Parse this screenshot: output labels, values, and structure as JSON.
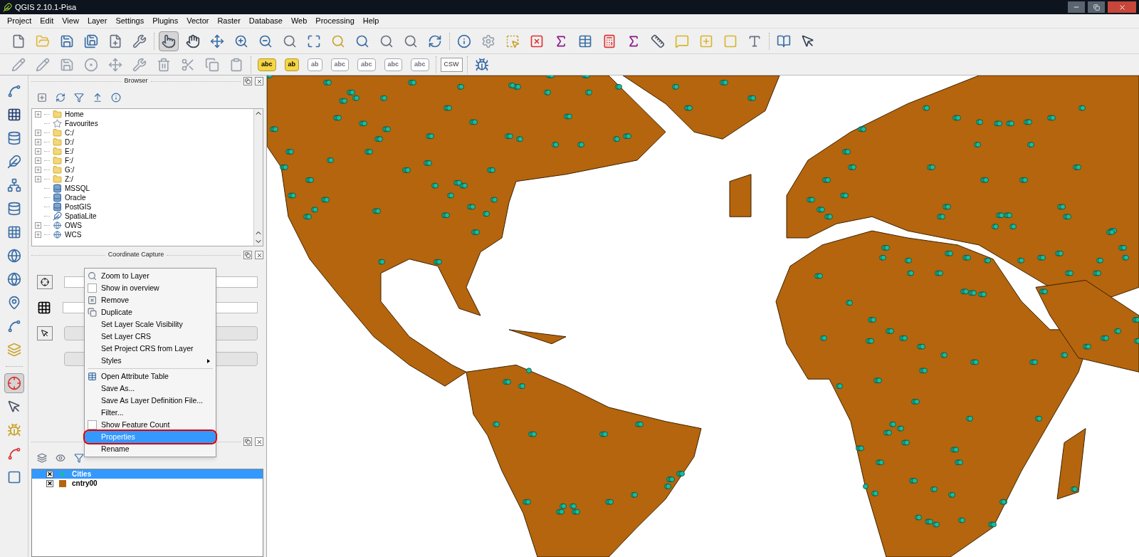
{
  "window": {
    "title": "QGIS 2.10.1-Pisa"
  },
  "menu": [
    "Project",
    "Edit",
    "View",
    "Layer",
    "Settings",
    "Plugins",
    "Vector",
    "Raster",
    "Database",
    "Web",
    "Processing",
    "Help"
  ],
  "pressed_tools": {
    "touch": true,
    "coordinate_capture": true
  },
  "label_toolbar": {
    "labels": [
      "abc",
      "ab",
      "ab",
      "abc",
      "abc",
      "abc",
      "abc"
    ],
    "csw": "CSW"
  },
  "browser": {
    "title": "Browser",
    "items": [
      {
        "label": "Home",
        "kind": "folder",
        "has_children": true
      },
      {
        "label": "Favourites",
        "kind": "star",
        "has_children": false
      },
      {
        "label": "C:/",
        "kind": "folder",
        "has_children": true
      },
      {
        "label": "D:/",
        "kind": "folder",
        "has_children": true
      },
      {
        "label": "E:/",
        "kind": "folder",
        "has_children": true
      },
      {
        "label": "F:/",
        "kind": "folder",
        "has_children": true
      },
      {
        "label": "G:/",
        "kind": "folder",
        "has_children": true
      },
      {
        "label": "Z:/",
        "kind": "folder",
        "has_children": true
      },
      {
        "label": "MSSQL",
        "kind": "database",
        "has_children": false
      },
      {
        "label": "Oracle",
        "kind": "database",
        "has_children": false
      },
      {
        "label": "PostGIS",
        "kind": "database",
        "has_children": false
      },
      {
        "label": "SpatiaLite",
        "kind": "feather",
        "has_children": false
      },
      {
        "label": "OWS",
        "kind": "globe",
        "has_children": true
      },
      {
        "label": "WCS",
        "kind": "globe",
        "has_children": true
      }
    ]
  },
  "coordinate_capture": {
    "title": "Coordinate Capture"
  },
  "context_menu": [
    {
      "kind": "icon",
      "label": "Zoom to Layer",
      "selected": false,
      "highlighted": false
    },
    {
      "kind": "checkbox",
      "label": "Show in overview",
      "checked": false,
      "selected": false,
      "highlighted": false
    },
    {
      "kind": "icon",
      "label": "Remove",
      "selected": false,
      "highlighted": false
    },
    {
      "kind": "icon",
      "label": "Duplicate",
      "selected": false,
      "highlighted": false
    },
    {
      "kind": "plain",
      "label": "Set Layer Scale Visibility",
      "selected": false,
      "highlighted": false
    },
    {
      "kind": "plain",
      "label": "Set Layer CRS",
      "selected": false,
      "highlighted": false
    },
    {
      "kind": "plain",
      "label": "Set Project CRS from Layer",
      "selected": false,
      "highlighted": false
    },
    {
      "kind": "submenu",
      "label": "Styles",
      "selected": false,
      "highlighted": false
    },
    {
      "kind": "separator"
    },
    {
      "kind": "icon",
      "label": "Open Attribute Table",
      "selected": false,
      "highlighted": false
    },
    {
      "kind": "plain",
      "label": "Save As...",
      "selected": false,
      "highlighted": false
    },
    {
      "kind": "plain",
      "label": "Save As Layer Definition File...",
      "selected": false,
      "highlighted": false
    },
    {
      "kind": "plain",
      "label": "Filter...",
      "selected": false,
      "highlighted": false
    },
    {
      "kind": "checkbox",
      "label": "Show Feature Count",
      "checked": false,
      "selected": false,
      "highlighted": false
    },
    {
      "kind": "plain",
      "label": "Properties",
      "selected": true,
      "highlighted": true
    },
    {
      "kind": "plain",
      "label": "Rename",
      "selected": false,
      "highlighted": false
    }
  ],
  "layers": [
    {
      "name": "Cities",
      "checked": true,
      "selected": true,
      "kind": "point",
      "color": "#1abc9c"
    },
    {
      "name": "cntry00",
      "checked": true,
      "selected": false,
      "kind": "polygon",
      "color": "#b5650d"
    }
  ]
}
